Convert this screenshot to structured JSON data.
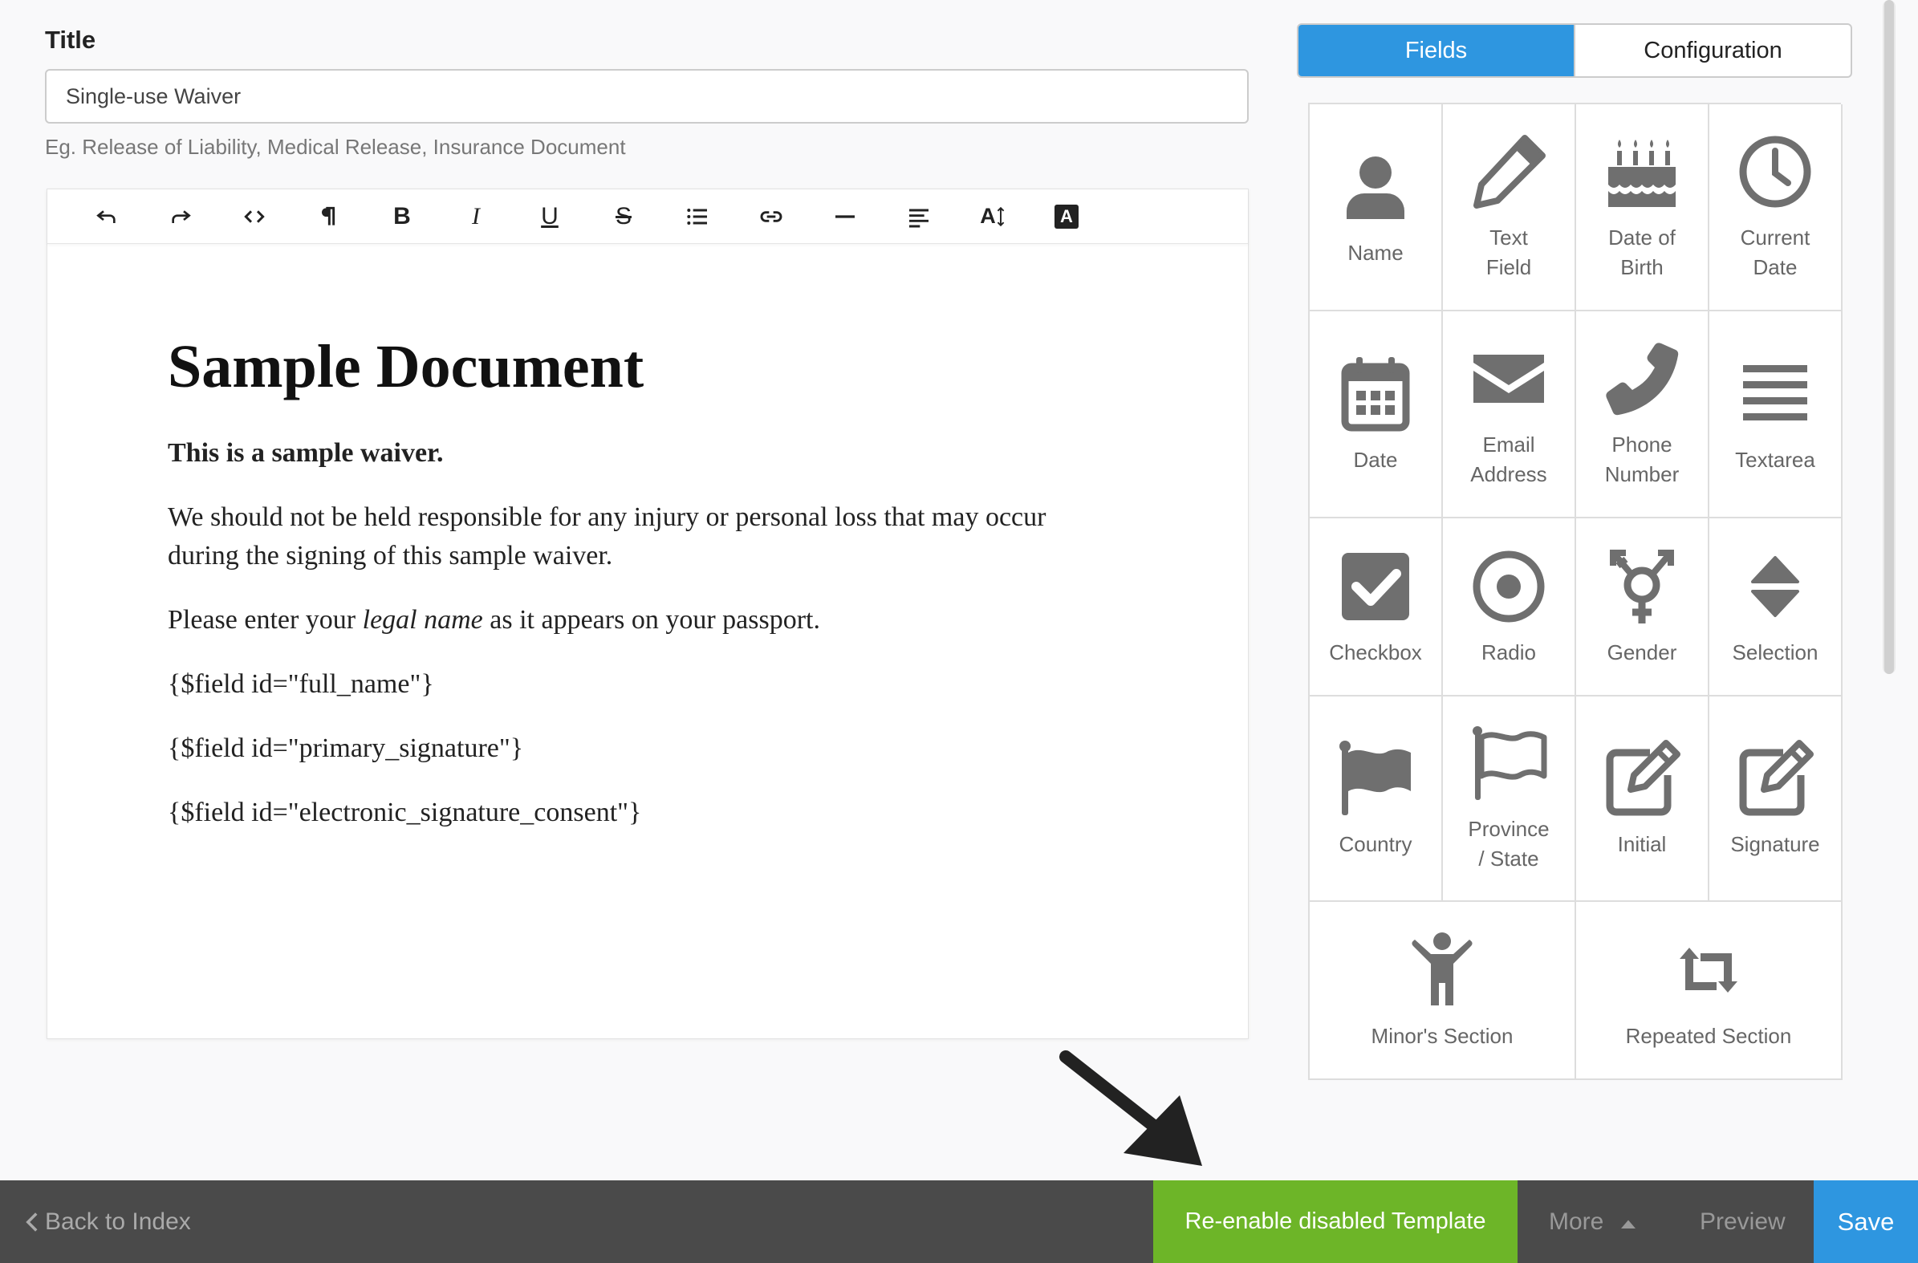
{
  "title_section": {
    "label": "Title",
    "value": "Single-use Waiver",
    "help": "Eg. Release of Liability, Medical Release, Insurance Document"
  },
  "toolbar": {
    "buttons": [
      {
        "name": "undo-icon"
      },
      {
        "name": "redo-icon"
      },
      {
        "name": "code-view-icon"
      },
      {
        "name": "paragraph-icon"
      },
      {
        "name": "bold-icon",
        "glyph": "B"
      },
      {
        "name": "italic-icon",
        "glyph": "I"
      },
      {
        "name": "underline-icon",
        "glyph": "U"
      },
      {
        "name": "strikethrough-icon",
        "glyph": "S"
      },
      {
        "name": "list-icon"
      },
      {
        "name": "link-icon"
      },
      {
        "name": "horizontal-rule-icon"
      },
      {
        "name": "align-icon"
      },
      {
        "name": "font-size-icon",
        "glyph": "A"
      },
      {
        "name": "font-color-icon",
        "glyph": "A"
      }
    ]
  },
  "document": {
    "heading": "Sample Document",
    "intro": "This is a sample waiver.",
    "paragraph1": "We should not be held responsible for any injury or personal loss that may occur during the signing of this sample waiver.",
    "p2_before": "Please enter your ",
    "p2_em": "legal name",
    "p2_after": " as it appears on your passport.",
    "field1": "{$field id=\"full_name\"}",
    "field2": "{$field id=\"primary_signature\"}",
    "field3": "{$field id=\"electronic_signature_consent\"}"
  },
  "tabs": {
    "fields": "Fields",
    "configuration": "Configuration",
    "active": "fields"
  },
  "fields": {
    "name": "Name",
    "text_field": "Text\nField",
    "date_of_birth": "Date of\nBirth",
    "current_date": "Current\nDate",
    "date": "Date",
    "email": "Email\nAddress",
    "phone": "Phone\nNumber",
    "textarea": "Textarea",
    "checkbox": "Checkbox",
    "radio": "Radio",
    "gender": "Gender",
    "selection": "Selection",
    "country": "Country",
    "province": "Province\n/ State",
    "initial": "Initial",
    "signature": "Signature",
    "minor": "Minor's Section",
    "repeated": "Repeated Section"
  },
  "footer": {
    "back": "Back to Index",
    "reenable": "Re-enable disabled Template",
    "more": "More",
    "preview": "Preview",
    "save": "Save"
  },
  "colors": {
    "accent_blue": "#2e96e0",
    "reenable_green": "#6db528",
    "footer_bg": "#4a4a4a",
    "icon_gray": "#6f6f6f"
  }
}
